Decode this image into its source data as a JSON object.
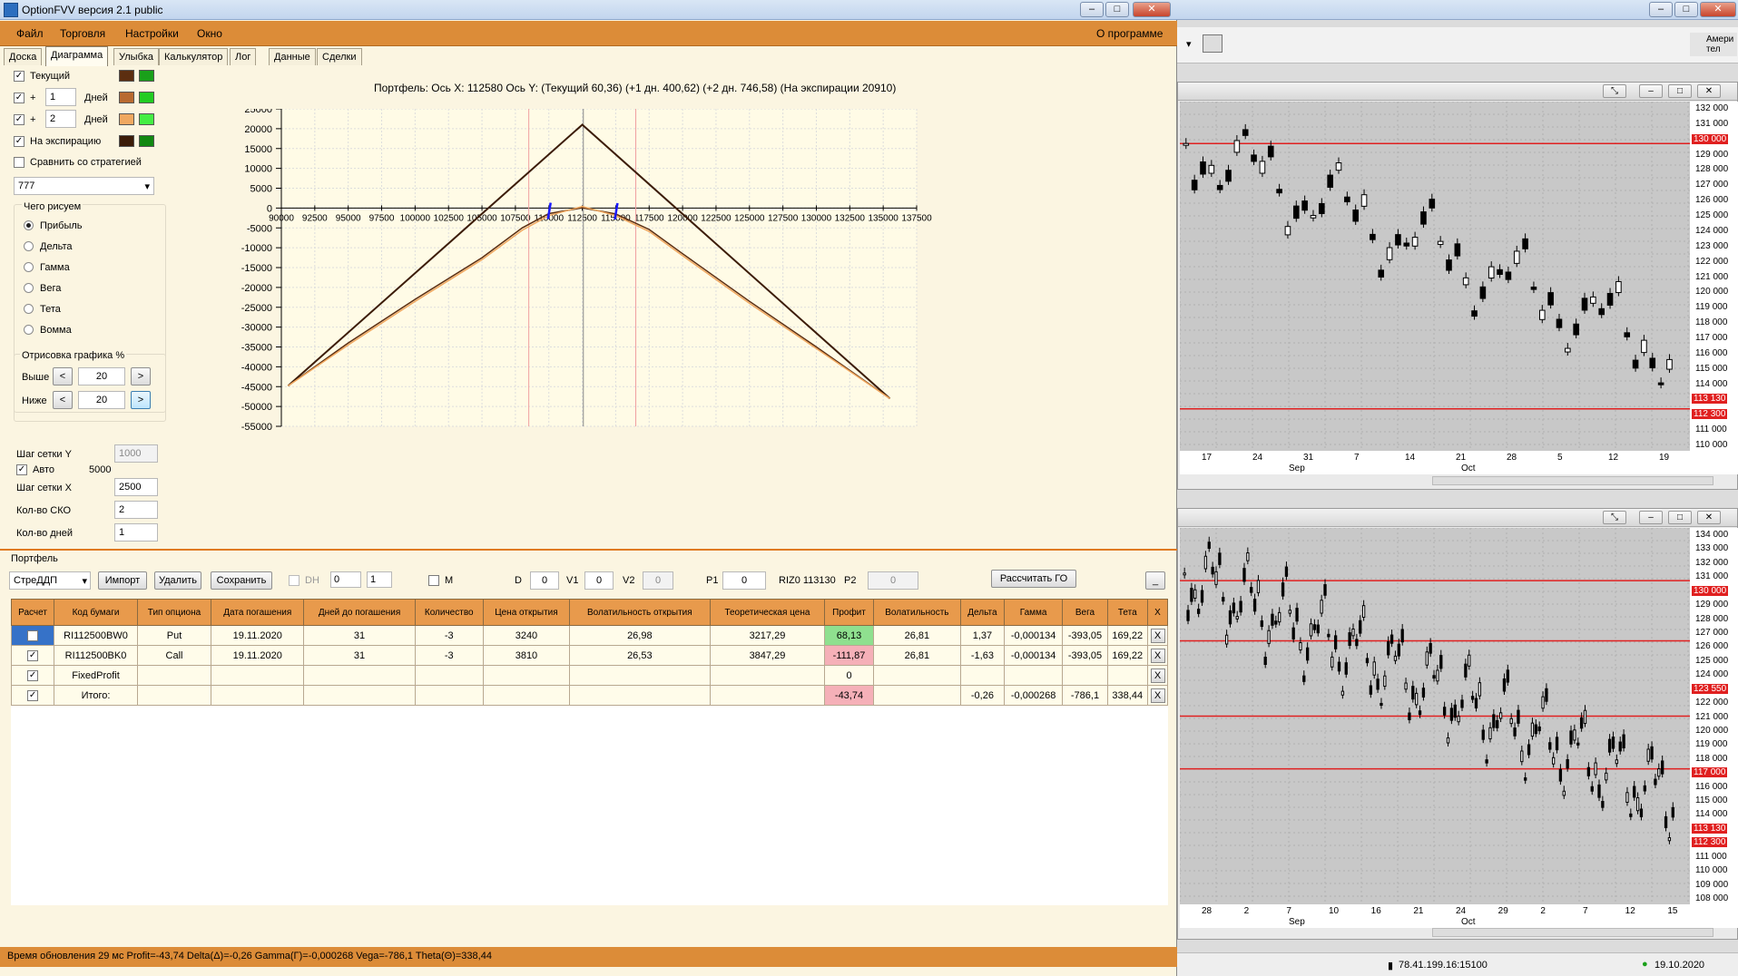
{
  "window": {
    "title": "OptionFVV версия 2.1 public"
  },
  "menu": {
    "file": "Файл",
    "trading": "Торговля",
    "settings": "Настройки",
    "window": "Окно",
    "about": "О программе"
  },
  "tabs": [
    "Доска",
    "Диаграмма",
    "Улыбка",
    "Калькулятор",
    "Лог",
    "Данные",
    "Сделки"
  ],
  "left": {
    "current": "Текущий",
    "plus": "+",
    "days": "Дней",
    "days1": "1",
    "days2": "2",
    "expiry": "На экспирацию",
    "compare": "Сравнить со стратегией",
    "strategy": "777",
    "draw_group": "Чего рисуем",
    "draw_options": [
      "Прибыль",
      "Дельта",
      "Гамма",
      "Вега",
      "Тета",
      "Вомма"
    ],
    "render_group": "Отрисовка графика %",
    "above": "Выше",
    "above_val": "20",
    "below": "Ниже",
    "below_val": "20",
    "prev": "<",
    "next": ">",
    "grid_y": "Шаг сетки Y",
    "grid_y_val": "1000",
    "auto": "Авто",
    "auto_val": "5000",
    "grid_x": "Шаг сетки X",
    "grid_x_val": "2500",
    "sko": "Кол-во СКО",
    "sko_val": "2",
    "ndays": "Кол-во дней",
    "ndays_val": "1"
  },
  "colors": {
    "current1": "#5c2e10",
    "current2": "#1aa01a",
    "d1a": "#b86a30",
    "d1b": "#22cc22",
    "d2a": "#f0a860",
    "d2b": "#44ee44",
    "exp1": "#3c1c08",
    "exp2": "#118811",
    "accent": "#dc8c38"
  },
  "chart_data": {
    "type": "line",
    "title": "Портфель:  Ось X:  112580  Ось Y:   (Текущий 60,36)   (+1 дн. 400,62)   (+2 дн. 746,58)   (На экспирации 20910)",
    "x_ticks": [
      "90000",
      "92500",
      "95000",
      "97500",
      "100000",
      "102500",
      "105000",
      "107500",
      "110000",
      "112500",
      "115000",
      "117500",
      "120000",
      "122500",
      "125000",
      "127500",
      "130000",
      "132500",
      "135000",
      "137500"
    ],
    "y_ticks": [
      "25000",
      "20000",
      "15000",
      "10000",
      "5000",
      "0",
      "-5000",
      "-10000",
      "-15000",
      "-20000",
      "-25000",
      "-30000",
      "-35000",
      "-40000",
      "-45000",
      "-50000",
      "-55000"
    ],
    "xlim": [
      90000,
      137500
    ],
    "ylim": [
      -55000,
      25000
    ],
    "series": [
      {
        "points": [
          [
            90500,
            -44800
          ],
          [
            112500,
            21000
          ],
          [
            135500,
            -48000
          ]
        ]
      },
      {
        "points": [
          [
            90500,
            -44800
          ],
          [
            95000,
            -34000
          ],
          [
            100000,
            -23000
          ],
          [
            105000,
            -12500
          ],
          [
            108000,
            -5000
          ],
          [
            110000,
            -1400
          ],
          [
            112500,
            60
          ],
          [
            115000,
            -1500
          ],
          [
            117500,
            -5400
          ],
          [
            120000,
            -11500
          ],
          [
            125000,
            -23500
          ],
          [
            130000,
            -35000
          ],
          [
            135500,
            -48000
          ]
        ]
      },
      {
        "points": [
          [
            90500,
            -44800
          ],
          [
            95000,
            -34500
          ],
          [
            100000,
            -23500
          ],
          [
            105000,
            -13000
          ],
          [
            108000,
            -5600
          ],
          [
            110000,
            -1900
          ],
          [
            112500,
            400
          ],
          [
            115000,
            -1900
          ],
          [
            117500,
            -5900
          ],
          [
            120000,
            -12000
          ],
          [
            125000,
            -24000
          ],
          [
            130000,
            -35400
          ],
          [
            135500,
            -48000
          ]
        ]
      }
    ]
  },
  "portfolio": {
    "label": "Портфель",
    "strategy": "СтреДДП",
    "import": "Импорт",
    "delete": "Удалить",
    "save": "Сохранить",
    "dh": "DH",
    "dh_val": "0",
    "dh_val2": "1",
    "m": "M",
    "d": "D",
    "d_val": "0",
    "v1": "V1",
    "v1_val": "0",
    "v2": "V2",
    "v2_val": "0",
    "p1": "P1",
    "p1_val": "0",
    "riz": "RIZ0 113130",
    "p2": "P2",
    "p2_val": "0",
    "calc_go": "Рассчитать ГО",
    "minimize": "_"
  },
  "table": {
    "headers": [
      "Расчет",
      "Код бумаги",
      "Тип опциона",
      "Дата погашения",
      "Дней до погашения",
      "Количество",
      "Цена открытия",
      "Волатильность открытия",
      "Теоретическая цена",
      "Профит",
      "Волатильность",
      "Дельта",
      "Гамма",
      "Вега",
      "Тета",
      "X"
    ],
    "rows": [
      [
        "✓",
        "RI112500BW0",
        "Put",
        "19.11.2020",
        "31",
        "-3",
        "3240",
        "26,98",
        "3217,29",
        "68,13",
        "26,81",
        "1,37",
        "-0,000134",
        "-393,05",
        "169,22",
        "X"
      ],
      [
        "✓",
        "RI112500BK0",
        "Call",
        "19.11.2020",
        "31",
        "-3",
        "3810",
        "26,53",
        "3847,29",
        "-111,87",
        "26,81",
        "-1,63",
        "-0,000134",
        "-393,05",
        "169,22",
        "X"
      ],
      [
        "✓",
        "FixedProfit",
        "",
        "",
        "",
        "",
        "",
        "",
        "",
        "0",
        "",
        "",
        "",
        "",
        "",
        "X"
      ],
      [
        "✓",
        "Итого:",
        "",
        "",
        "",
        "",
        "",
        "",
        "",
        "-43,74",
        "",
        "-0,26",
        "-0,000268",
        "-786,1",
        "338,44",
        "X"
      ]
    ]
  },
  "status": "Время обновления 29 мс  Profit=-43,74 Delta(Δ)=-0,26 Gamma(Γ)=-0,000268 Vega=-786,1 Theta(Θ)=338,44",
  "right": {
    "top_axis": [
      "132 000",
      "131 000",
      "130 000",
      "129 000",
      "128 000",
      "127 000",
      "126 000",
      "125 000",
      "124 000",
      "123 000",
      "122 000",
      "121 000",
      "120 000",
      "119 000",
      "118 000",
      "117 000",
      "116 000",
      "115 000",
      "114 000",
      "113 130",
      "112 300",
      "111 000",
      "110 000"
    ],
    "top_dates": [
      "17",
      "24",
      "31",
      "7",
      "14",
      "21",
      "28",
      "5",
      "12",
      "19"
    ],
    "top_months": [
      "Sep",
      "Oct"
    ],
    "bot_axis": [
      "134 000",
      "133 000",
      "132 000",
      "131 000",
      "130 000",
      "129 000",
      "128 000",
      "127 000",
      "126 000",
      "125 000",
      "124 000",
      "123 550",
      "122 000",
      "121 000",
      "120 000",
      "119 000",
      "118 000",
      "117 000",
      "116 000",
      "115 000",
      "114 000",
      "113 130",
      "112 300",
      "111 000",
      "110 000",
      "109 000",
      "108 000"
    ],
    "bot_dates": [
      "28",
      "2",
      "7",
      "10",
      "16",
      "21",
      "24",
      "29",
      "2",
      "7",
      "12",
      "15"
    ],
    "bot_months": [
      "Sep",
      "Oct"
    ],
    "partial_label": "Амери тел",
    "ip": "78.41.199.16:15100",
    "date": "19.10.2020"
  }
}
